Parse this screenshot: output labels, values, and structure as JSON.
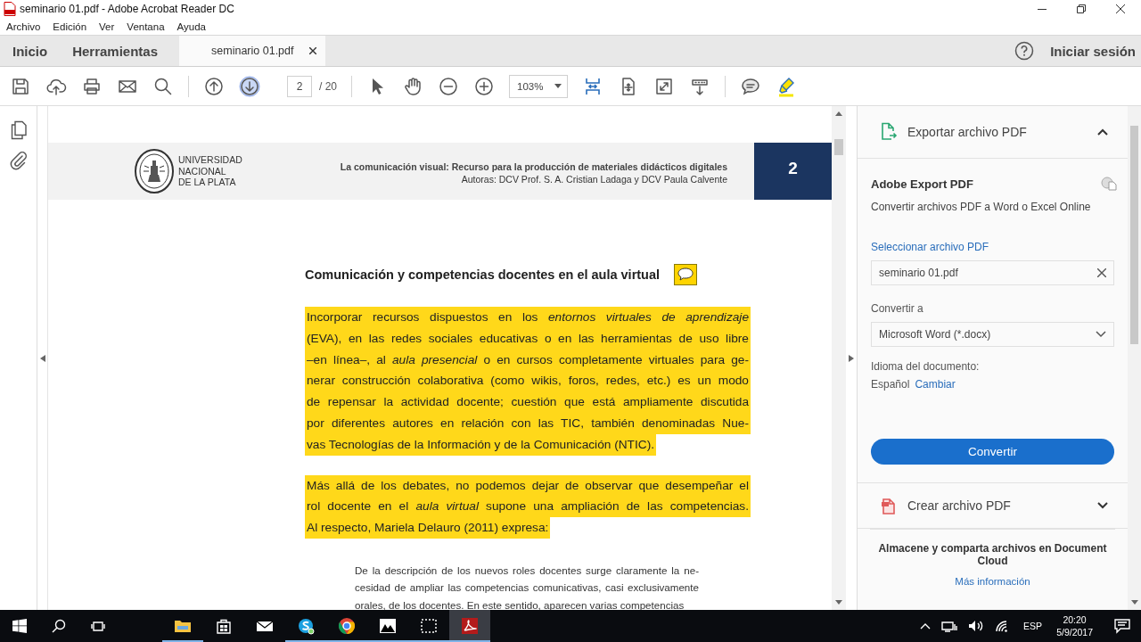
{
  "window": {
    "title": "seminario 01.pdf - Adobe Acrobat Reader DC"
  },
  "menu": [
    "Archivo",
    "Edición",
    "Ver",
    "Ventana",
    "Ayuda"
  ],
  "nav_tabs": [
    {
      "label": "Inicio",
      "selected": false
    },
    {
      "label": "Herramientas",
      "selected": false
    }
  ],
  "document_tabs": [
    {
      "label": "seminario 01.pdf",
      "selected": true
    }
  ],
  "account": {
    "label": "Iniciar sesión"
  },
  "toolbar": [
    {
      "kind": "save",
      "hovered": false
    },
    {
      "kind": "upload",
      "hovered": false
    },
    {
      "kind": "print",
      "hovered": false
    },
    {
      "kind": "mail",
      "hovered": false
    },
    {
      "kind": "search",
      "hovered": false
    },
    {
      "kind": "separator"
    },
    {
      "kind": "prev",
      "hovered": false
    },
    {
      "kind": "next",
      "hovered": true
    },
    {
      "kind": "page",
      "value": "2",
      "total": "/ 20"
    },
    {
      "kind": "separator"
    },
    {
      "kind": "select",
      "hovered": false
    },
    {
      "kind": "hand",
      "hovered": false
    },
    {
      "kind": "zoom-out",
      "hovered": false
    },
    {
      "kind": "zoom-in",
      "hovered": false
    },
    {
      "kind": "zoom",
      "value": "103%"
    },
    {
      "kind": "fit-width",
      "hovered": false
    },
    {
      "kind": "fit-page",
      "hovered": false
    },
    {
      "kind": "full-screen",
      "hovered": false
    },
    {
      "kind": "scroll-mode",
      "hovered": false
    },
    {
      "kind": "separator"
    },
    {
      "kind": "comment",
      "hovered": false
    },
    {
      "kind": "highlight",
      "hovered": false
    }
  ],
  "document": {
    "header": {
      "institution": [
        "UNIVERSIDAD",
        "NACIONAL",
        "DE LA PLATA"
      ],
      "title": "La comunicación visual: Recurso para la producción de materiales didácticos digitales",
      "authors": "Autoras: DCV Prof. S. A. Cristian Ladaga y DCV Paula Calvente",
      "page_number": "2"
    },
    "heading": "Comunicación y competencias docentes en el aula virtual",
    "paragraphs": [
      {
        "kind": "body",
        "highlighted": true,
        "lines": [
          "Incorporar recursos dispuestos en los *entornos virtuales de aprendizaje*",
          "(EVA), en las redes sociales educativas o en las herramientas de uso libre",
          "–en línea–, al *aula presencial* o en cursos completamente virtuales para ge-",
          "nerar construcción colaborativa (como wikis, foros, redes, etc.) es un modo",
          "de repensar la actividad docente; cuestión que está ampliamente discutida",
          "por diferentes autores en relación con las TIC, también denominadas Nue-",
          "vas Tecnologías de la Información y de la Comunicación (NTIC)."
        ]
      },
      {
        "kind": "body",
        "highlighted": true,
        "lines": [
          "Más allá de los debates, no podemos dejar de observar que desempeñar el",
          "rol docente en el *aula virtual* supone una ampliación de las competencias.",
          "Al respecto, Mariela Delauro (2011) expresa:"
        ]
      },
      {
        "kind": "quote",
        "highlighted": false,
        "lines": [
          "De la descripción de los nuevos roles docentes surge claramente la ne-",
          "cesidad de ampliar las competencias comunicativas, casi exclusivamente",
          "orales, de los docentes. En este sentido, aparecen varias competencias"
        ]
      }
    ]
  },
  "export_panel": {
    "title": "Exportar archivo PDF",
    "expanded": true,
    "service": "Adobe Export PDF",
    "description": "Convertir archivos PDF a Word o Excel Online",
    "select_label": "Seleccionar archivo PDF",
    "file": "seminario 01.pdf",
    "convert_label": "Convertir a",
    "format": "Microsoft Word (*.docx)",
    "language_label": "Idioma del documento:",
    "language": "Español",
    "change_link": "Cambiar",
    "button": "Convertir"
  },
  "create_panel": {
    "title": "Crear archivo PDF",
    "expanded": false
  },
  "cloud": {
    "message": "Almacene y comparta archivos en Document Cloud",
    "link": "Más información"
  },
  "taskbar": {
    "apps": [
      {
        "kind": "explorer",
        "running": true,
        "active": false
      },
      {
        "kind": "store",
        "running": false,
        "active": false
      },
      {
        "kind": "mail",
        "running": false,
        "active": false
      },
      {
        "kind": "skype",
        "running": true,
        "active": false
      },
      {
        "kind": "chrome",
        "running": true,
        "active": false
      },
      {
        "kind": "photos",
        "running": true,
        "active": false
      },
      {
        "kind": "snip",
        "running": true,
        "active": false
      },
      {
        "kind": "acrobat",
        "running": true,
        "active": true
      }
    ],
    "language": "ESP",
    "time": "20:20",
    "date": "5/9/2017"
  }
}
